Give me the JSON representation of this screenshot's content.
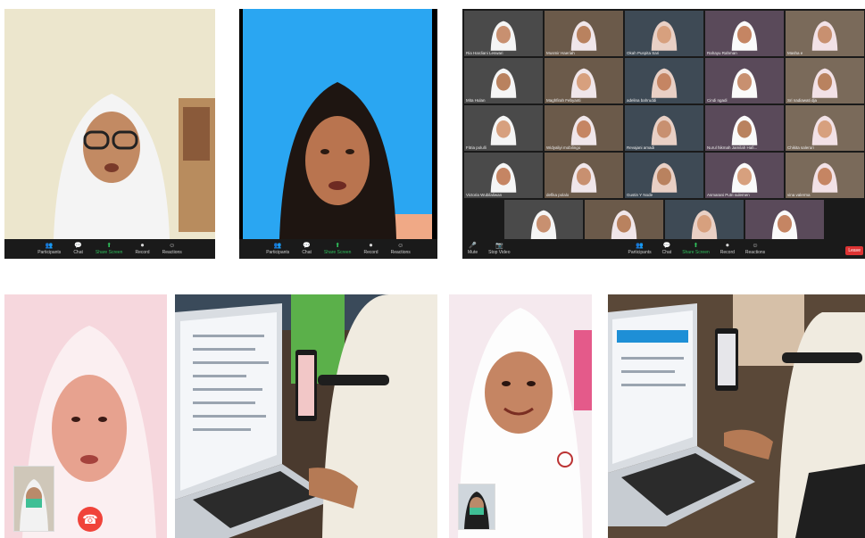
{
  "zoom_toolbar": {
    "participants": "Participants",
    "chat": "Chat",
    "share_screen": "Share Screen",
    "record": "Record",
    "reactions": "Reactions",
    "mute": "Mute",
    "stop_video": "Stop Video",
    "leave": "Leave",
    "speaker_view": "Speaker View",
    "participant_count_1": "14",
    "participant_count_2": "29"
  },
  "gallery": {
    "names": [
      "Ria Hardiani Leswari",
      "Musmir Haeriah",
      "Okah Puspita Sari",
      "Rahayu Rahman",
      "Masha e",
      "Mita Hulan",
      "Maghfirah Febyanti",
      "adelina bahruddi",
      "Cindi ngadi",
      "Sri nadiawati dja",
      "Fitria polulli",
      "Widyaliyi mobilingo",
      "Revajani amadi",
      "Nurul hikmah Jamilah Hafi...",
      "Chikita saleruri",
      "Victoria Wubilaliwan",
      "defika polalo",
      "Gustin Y Node",
      "Asmarani Putri sulemen",
      "vina valerma",
      "Anggriani Dunggio",
      "Regina putri mokodompit",
      "Isnawaty sahi",
      "Rahmawati kastela"
    ]
  },
  "icons": {
    "end_call": "phone-hangup-icon"
  },
  "colors": {
    "zoom_bg": "#1a1a1a",
    "share_green": "#2fbf5b",
    "end_call_red": "#f0433a",
    "blue_bg": "#2aa6f2"
  }
}
